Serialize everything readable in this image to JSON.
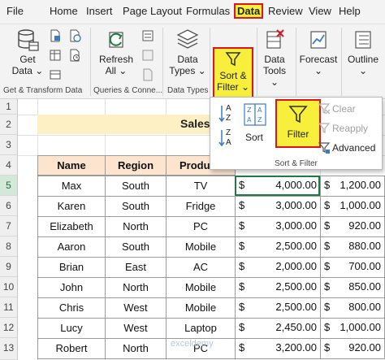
{
  "menu": [
    "File",
    "Home",
    "Insert",
    "Page Layout",
    "Formulas",
    "Data",
    "Review",
    "View",
    "Help"
  ],
  "ribbon": {
    "get_data": [
      "Get",
      "Data ⌄"
    ],
    "refresh": [
      "Refresh",
      "All ⌄"
    ],
    "data_types": [
      "Data",
      "Types ⌄"
    ],
    "sort_filter": [
      "Sort &",
      "Filter ⌄"
    ],
    "data_tools": [
      "Data",
      "Tools ⌄"
    ],
    "forecast": "Forecast",
    "outline": "Outline",
    "groups": [
      "Get & Transform Data",
      "Queries & Conne...",
      "Data Types"
    ]
  },
  "dropdown": {
    "sort_label": "Sort",
    "filter_label": "Filter",
    "clear": "Clear",
    "reapply": "Reapply",
    "advanced": "Advanced",
    "group": "Sort & Filter",
    "az_top": "A",
    "az_bottom": "Z",
    "za_top": "Z",
    "za_bottom": "A"
  },
  "rows": [
    "1",
    "2",
    "3",
    "4",
    "5",
    "6",
    "7",
    "8",
    "9",
    "10",
    "11",
    "12",
    "13"
  ],
  "sheet": {
    "title": "Sales",
    "headers": [
      "Name",
      "Region",
      "Produc"
    ],
    "data": [
      [
        "Max",
        "South",
        "TV",
        "$",
        "4,000.00",
        "$",
        "1,200.00"
      ],
      [
        "Karen",
        "South",
        "Fridge",
        "$",
        "3,000.00",
        "$",
        "1,000.00"
      ],
      [
        "Elizabeth",
        "North",
        "PC",
        "$",
        "3,000.00",
        "$",
        "920.00"
      ],
      [
        "Aaron",
        "South",
        "Mobile",
        "$",
        "2,500.00",
        "$",
        "880.00"
      ],
      [
        "Brian",
        "East",
        "AC",
        "$",
        "2,000.00",
        "$",
        "700.00"
      ],
      [
        "John",
        "North",
        "Mobile",
        "$",
        "2,500.00",
        "$",
        "850.00"
      ],
      [
        "Chris",
        "West",
        "Mobile",
        "$",
        "2,500.00",
        "$",
        "800.00"
      ],
      [
        "Lucy",
        "West",
        "Laptop",
        "$",
        "2,450.00",
        "$",
        "1,000.00"
      ],
      [
        "Robert",
        "North",
        "PC",
        "$",
        "3,200.00",
        "$",
        "920.00"
      ]
    ]
  },
  "watermark": "exceldemy",
  "colors": {
    "highlight": "#f7ef3c",
    "outline": "#e0141e",
    "header_fill": "#fce4ce",
    "title_fill": "#fdf0c4",
    "excel_green": "#1e7b45"
  }
}
